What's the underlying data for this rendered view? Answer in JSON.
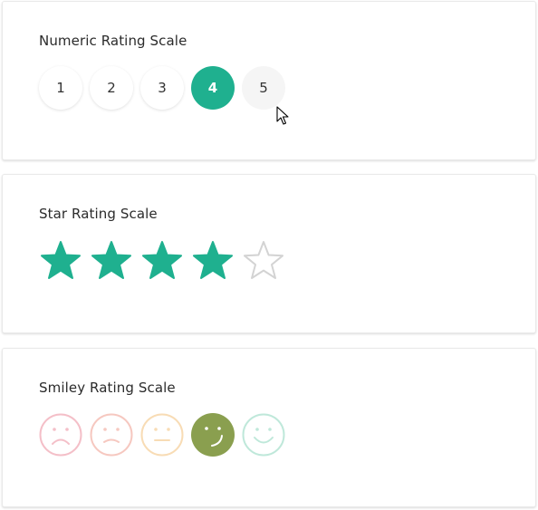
{
  "numeric": {
    "title": "Numeric Rating Scale",
    "options": [
      "1",
      "2",
      "3",
      "4",
      "5"
    ],
    "selected": "4",
    "hovered": "5"
  },
  "star": {
    "title": "Star Rating Scale",
    "max": 5,
    "value": 4,
    "filled_color": "#1fb08f",
    "empty_color": "#d3d3d3"
  },
  "smiley": {
    "title": "Smiley Rating Scale",
    "options": [
      {
        "icon": "very-sad-face-icon",
        "color": "#f4bfc8"
      },
      {
        "icon": "sad-face-icon",
        "color": "#f6c8c0"
      },
      {
        "icon": "neutral-face-icon",
        "color": "#f8dcb5"
      },
      {
        "icon": "smiling-face-icon",
        "color": "#8a9f4f"
      },
      {
        "icon": "happy-face-icon",
        "color": "#bfe8da"
      }
    ],
    "selected_index": 3
  },
  "colors": {
    "accent": "#1fb08f",
    "selected_smiley_bg": "#8a9f4f"
  }
}
